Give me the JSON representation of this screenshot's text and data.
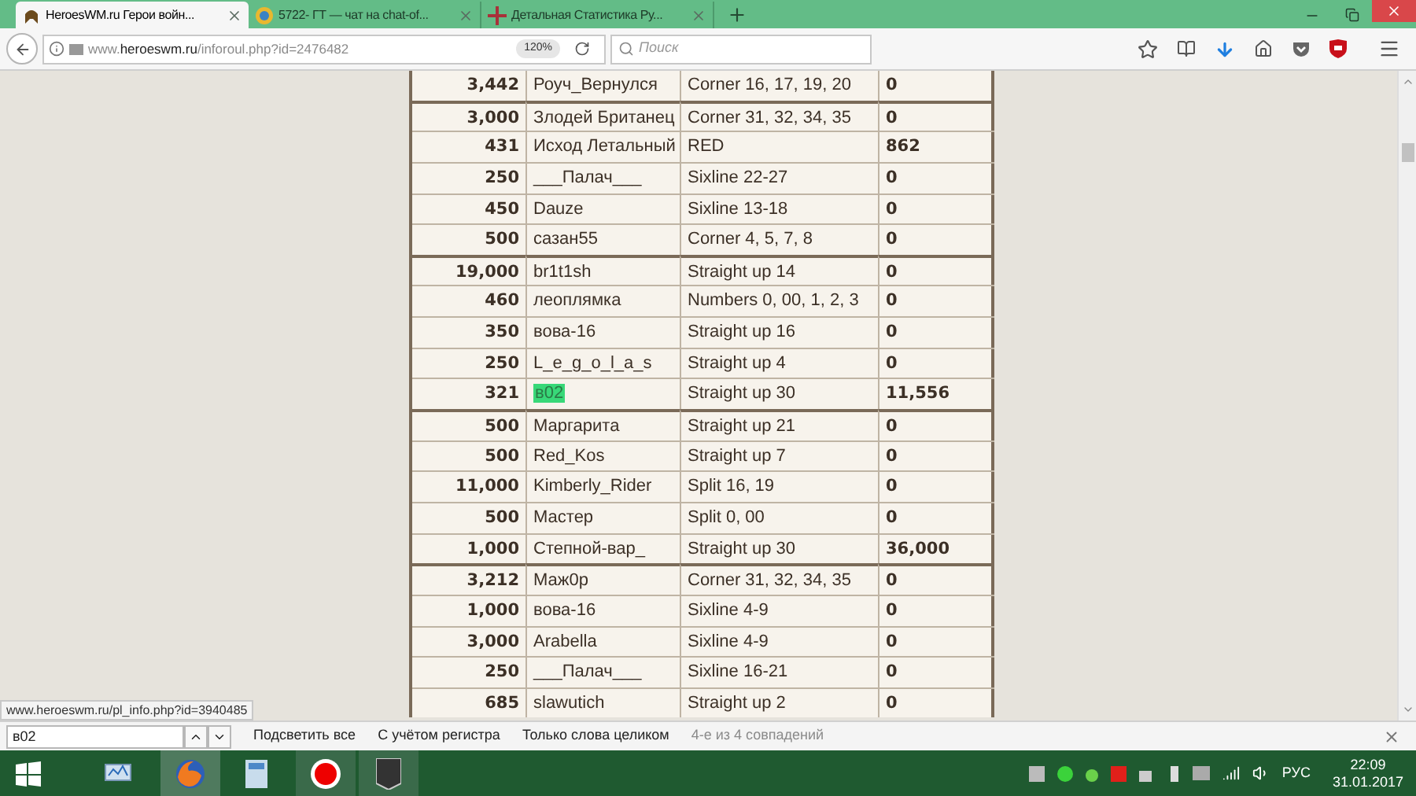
{
  "tabs": [
    {
      "title": "HeroesWM.ru Герои войн...",
      "selected": true
    },
    {
      "title": "5722- ГТ — чат на chat-of...",
      "selected": false
    },
    {
      "title": "Детальная Статистика Ру...",
      "selected": false
    }
  ],
  "address": {
    "url": "www.**heroeswm.ru**/inforoul.php?id=2476482",
    "zoom": "120%"
  },
  "search": {
    "placeholder": "Поиск"
  },
  "table": {
    "groups": [
      [
        {
          "bet": "3,442",
          "player": "Роуч_Вернулся",
          "wager": "Corner 16, 17, 19, 20",
          "win": "0",
          "match": false
        }
      ],
      [
        {
          "bet": "3,000",
          "player": "Злодей Британец",
          "wager": "Corner 31, 32, 34, 35",
          "win": "0",
          "match": false
        },
        {
          "bet": "431",
          "player": "Исход Летальный",
          "wager": "RED",
          "win": "862",
          "match": false
        },
        {
          "bet": "250",
          "player": "___Палач___",
          "wager": "Sixline 22-27",
          "win": "0",
          "match": false
        },
        {
          "bet": "450",
          "player": "Dauze",
          "wager": "Sixline 13-18",
          "win": "0",
          "match": false
        },
        {
          "bet": "500",
          "player": "сазан55",
          "wager": "Corner 4, 5, 7, 8",
          "win": "0",
          "match": false
        }
      ],
      [
        {
          "bet": "19,000",
          "player": "br1t1sh",
          "wager": "Straight up 14",
          "win": "0",
          "match": false
        },
        {
          "bet": "460",
          "player": "леоплямка",
          "wager": "Numbers 0, 00, 1, 2, 3",
          "win": "0",
          "match": false
        },
        {
          "bet": "350",
          "player": "вова-16",
          "wager": "Straight up 16",
          "win": "0",
          "match": false
        },
        {
          "bet": "250",
          "player": "L_e_g_o_l_a_s",
          "wager": "Straight up 4",
          "win": "0",
          "match": false
        },
        {
          "bet": "321",
          "player": "в02",
          "wager": "Straight up 30",
          "win": "11,556",
          "match": true
        }
      ],
      [
        {
          "bet": "500",
          "player": "Маргарита",
          "wager": "Straight up 21",
          "win": "0",
          "match": false
        },
        {
          "bet": "500",
          "player": "Red_Kos",
          "wager": "Straight up 7",
          "win": "0",
          "match": false
        },
        {
          "bet": "11,000",
          "player": "Kimberly_Rider",
          "wager": "Split 16, 19",
          "win": "0",
          "match": false
        },
        {
          "bet": "500",
          "player": "Мастер",
          "wager": "Split 0, 00",
          "win": "0",
          "match": false
        },
        {
          "bet": "1,000",
          "player": "Степной-вар_",
          "wager": "Straight up 30",
          "win": "36,000",
          "match": false
        }
      ],
      [
        {
          "bet": "3,212",
          "player": "Маж0р",
          "wager": "Corner 31, 32, 34, 35",
          "win": "0",
          "match": false
        },
        {
          "bet": "1,000",
          "player": "вова-16",
          "wager": "Sixline 4-9",
          "win": "0",
          "match": false
        },
        {
          "bet": "3,000",
          "player": "Arabella",
          "wager": "Sixline 4-9",
          "win": "0",
          "match": false
        },
        {
          "bet": "250",
          "player": "___Палач___",
          "wager": "Sixline 16-21",
          "win": "0",
          "match": false
        },
        {
          "bet": "685",
          "player": "slawutich",
          "wager": "Straight up 2",
          "win": "0",
          "match": false
        }
      ]
    ]
  },
  "status_link": "www.heroeswm.ru/pl_info.php?id=3940485",
  "find_bar": {
    "value": "в02",
    "options": [
      "Подсветить все",
      "С учётом регистра",
      "Только слова целиком"
    ],
    "result": "4-е из 4 совпадений"
  },
  "taskbar": {
    "language": "РУС",
    "time": "22:09",
    "date": "31.01.2017"
  }
}
